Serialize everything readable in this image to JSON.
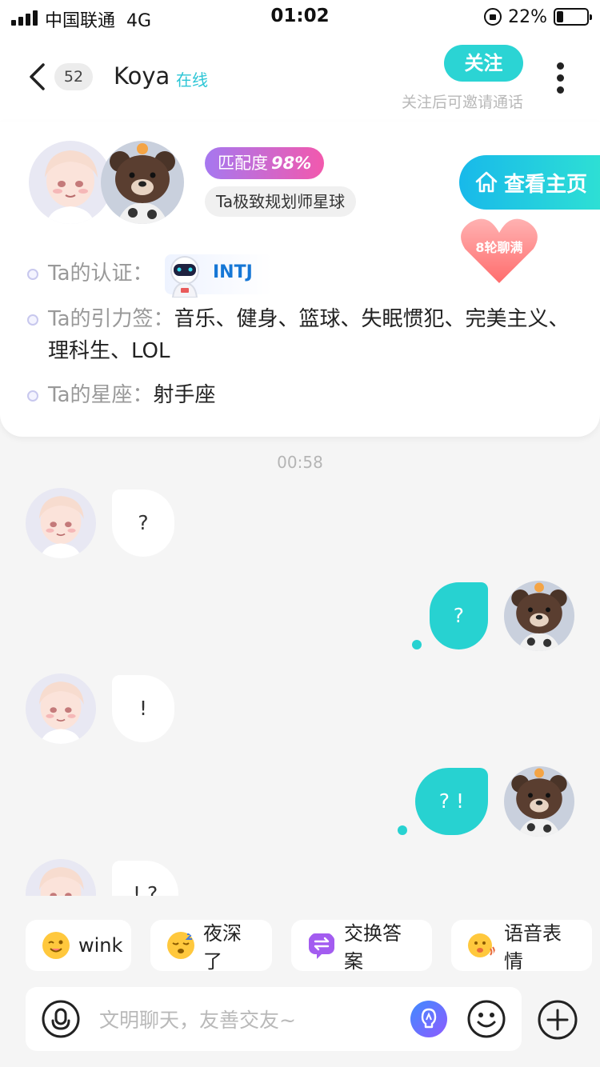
{
  "status_bar": {
    "carrier": "中国联通",
    "network": "4G",
    "time": "01:02",
    "battery_percent": "22%",
    "battery_level": 0.22
  },
  "header": {
    "unread_count": "52",
    "name": "Koya",
    "status": "在线",
    "follow_label": "关注",
    "follow_hint": "关注后可邀请通话"
  },
  "profile": {
    "match_label": "匹配度",
    "match_value": "98%",
    "planet_tag": "Ta极致规划师星球",
    "view_home_label": "查看主页",
    "chat_rounds_badge": "8轮聊满",
    "cert_label": "Ta的认证：",
    "cert_value": "INTJ",
    "tags_label": "Ta的引力签：",
    "tags_value": "音乐、健身、篮球、失眠惯犯、完美主义、理科生、LOL",
    "star_label": "Ta的星座：",
    "star_value": "射手座"
  },
  "chat": {
    "timestamp": "00:58",
    "messages": [
      {
        "from": "them",
        "text": "?"
      },
      {
        "from": "me",
        "text": "?"
      },
      {
        "from": "them",
        "text": "!"
      },
      {
        "from": "me",
        "text": "? !"
      },
      {
        "from": "them",
        "text": "! ?"
      }
    ]
  },
  "quick_replies": [
    {
      "label": "wink",
      "icon": "wink-emoji-icon"
    },
    {
      "label": "夜深了",
      "icon": "sleepy-emoji-icon"
    },
    {
      "label": "交换答案",
      "icon": "swap-icon"
    },
    {
      "label": "语音表情",
      "icon": "voice-emoji-icon"
    }
  ],
  "input": {
    "placeholder": "文明聊天，友善交友~"
  },
  "colors": {
    "accent": "#27d2d1",
    "online": "#2dc6d6",
    "match_gradient_start": "#a678f0",
    "match_gradient_end": "#f259ad",
    "heart": "#ff6b6b"
  }
}
